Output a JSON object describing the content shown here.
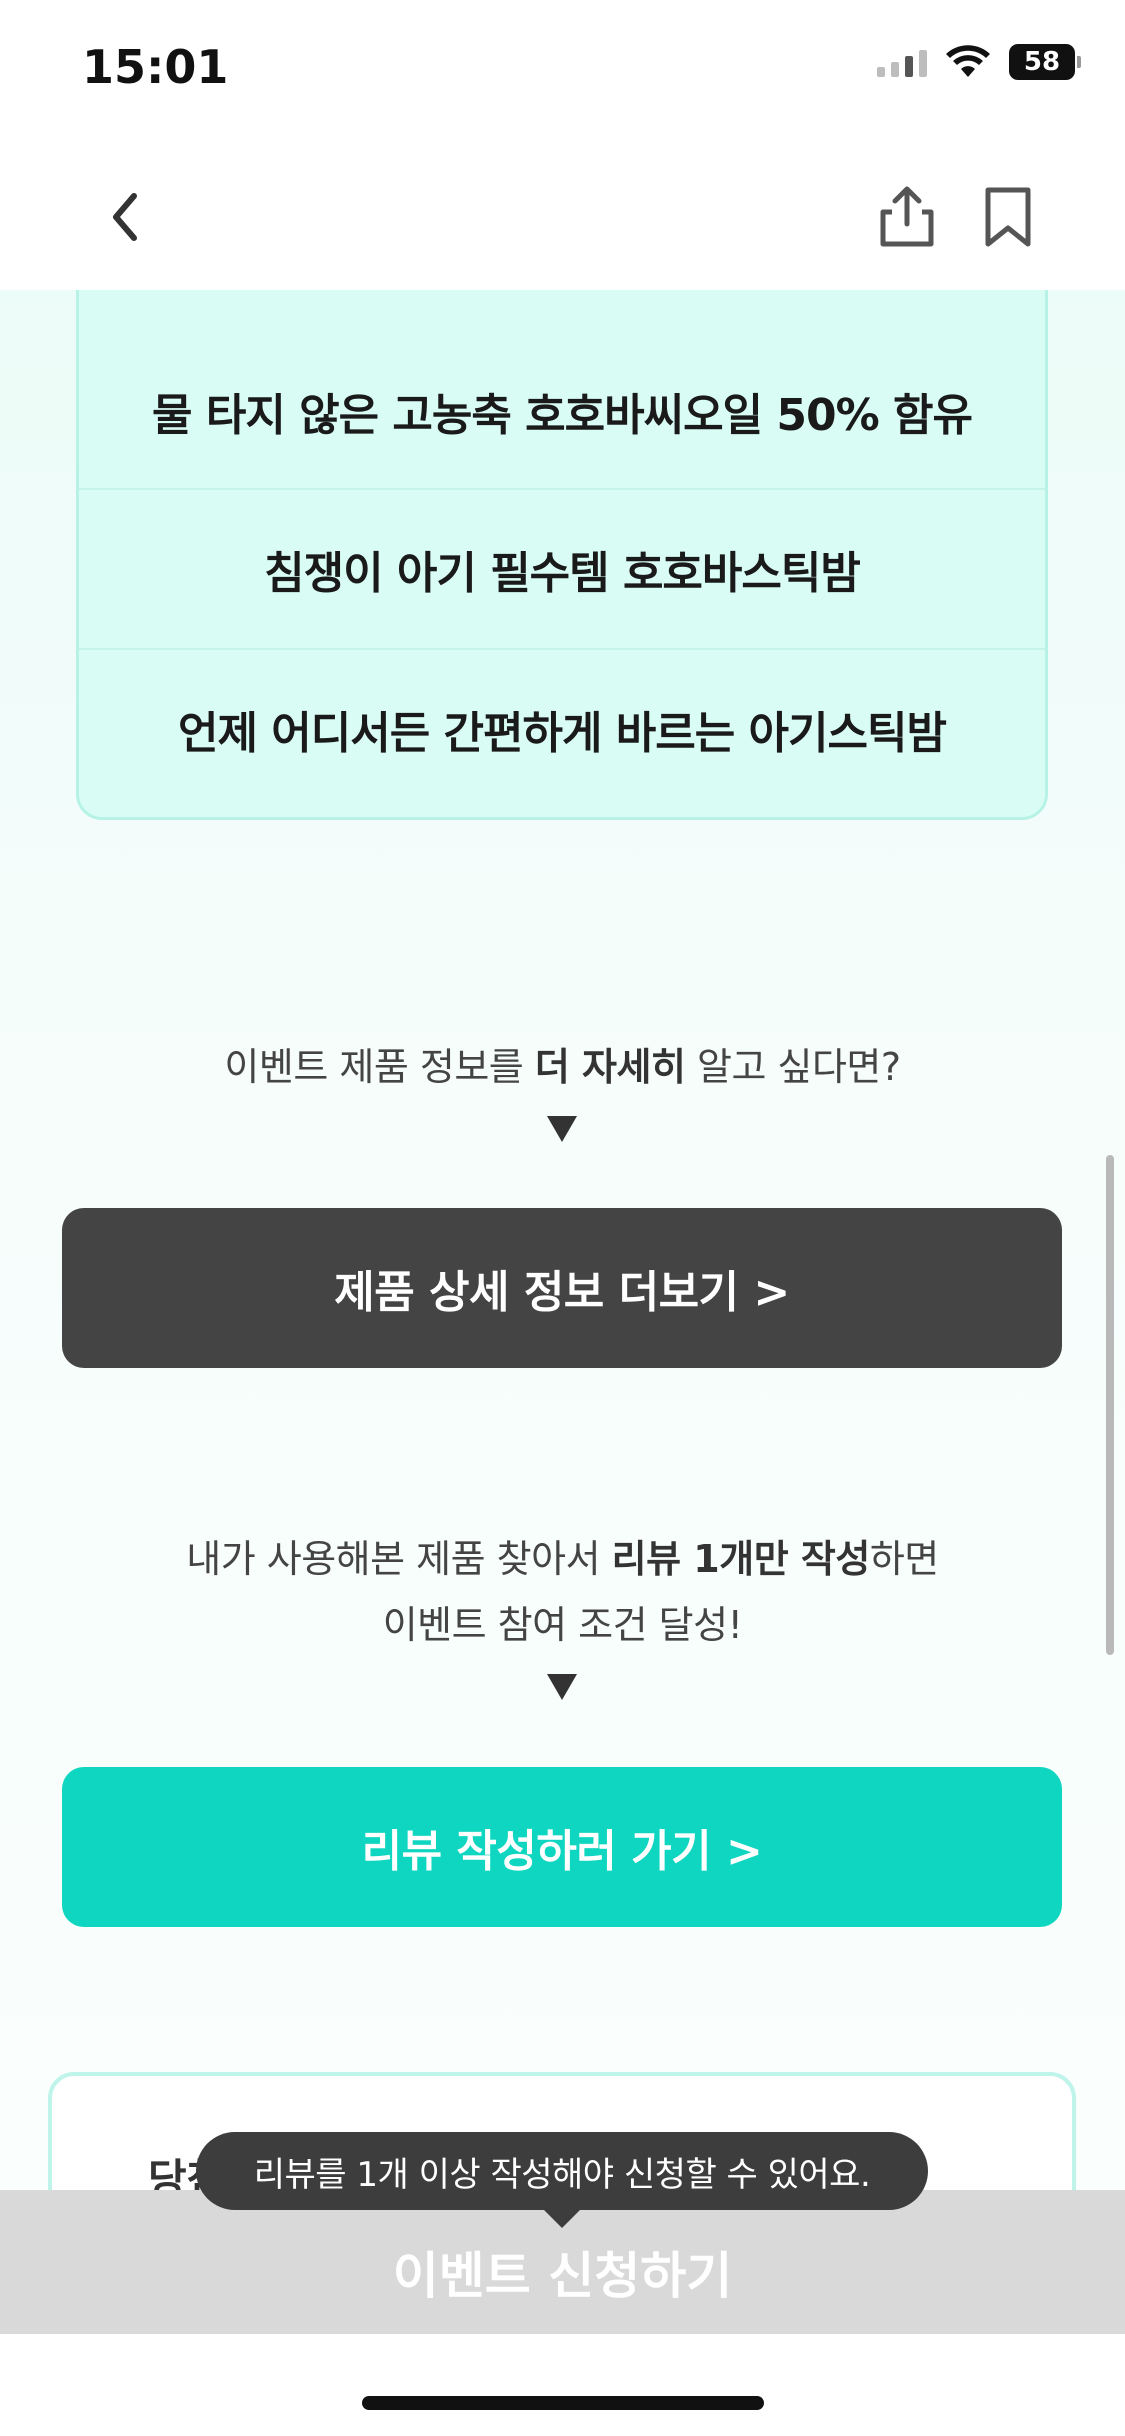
{
  "status_bar": {
    "time": "15:01",
    "battery": "58"
  },
  "nav": {
    "back_icon": "chevron-left-icon",
    "share_icon": "share-icon",
    "bookmark_icon": "bookmark-icon"
  },
  "features": [
    "물 타지 않은 고농축 호호바씨오일 50% 함유",
    "침쟁이 아기 필수템 호호바스틱밤",
    "언제 어디서든 간편하게 바르는 아기스틱밤"
  ],
  "detail_info": {
    "prefix": "이벤트 제품 정보를 ",
    "bold": "더 자세히",
    "suffix": " 알고 싶다면?"
  },
  "detail_button": {
    "label": "제품 상세 정보 더보기 >"
  },
  "review_info": {
    "line1_prefix": "내가 사용해본 제품 찾아서 ",
    "line1_bold": "리뷰 1개만 작성",
    "line1_suffix": "하면",
    "line2": "이벤트 참여 조건 달성!"
  },
  "review_button": {
    "label": "리뷰 작성하러 가기 >"
  },
  "winner_card": {
    "title_partial": "당첨"
  },
  "tooltip": {
    "text": "리뷰를 1개 이상 작성해야 신청할 수 있어요."
  },
  "apply_button": {
    "label": "이벤트 신청하기"
  },
  "colors": {
    "teal": "#0fd6c1",
    "dark_button": "#444444",
    "card_bg": "#d9fdf5"
  }
}
